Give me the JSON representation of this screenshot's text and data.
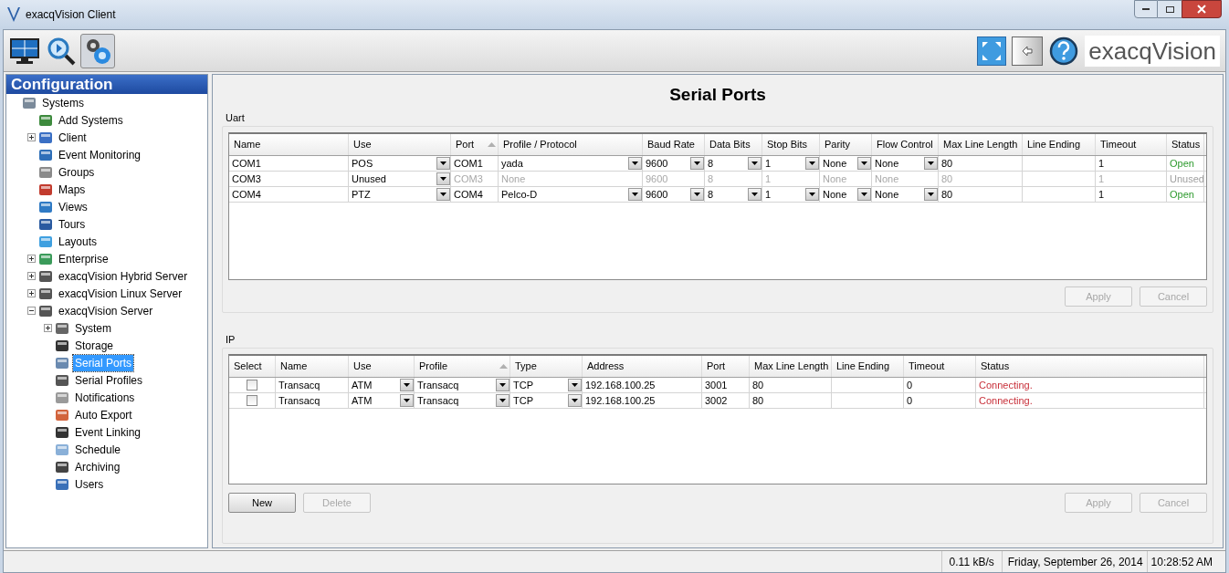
{
  "window": {
    "title": "exacqVision Client"
  },
  "toolbar": {
    "modes": [
      {
        "selected": false
      },
      {
        "selected": false
      },
      {
        "selected": true
      }
    ],
    "brand": "exacqVision"
  },
  "sidebar": {
    "title": "Configuration",
    "tree": [
      {
        "label": "Systems",
        "selected": false,
        "children": [
          {
            "label": "Add Systems",
            "selected": false
          },
          {
            "label": "Client",
            "selected": false,
            "expanded": false
          },
          {
            "label": "Event Monitoring",
            "selected": false
          },
          {
            "label": "Groups",
            "selected": false
          },
          {
            "label": "Maps",
            "selected": false
          },
          {
            "label": "Views",
            "selected": false
          },
          {
            "label": "Tours",
            "selected": false
          },
          {
            "label": "Layouts",
            "selected": false
          },
          {
            "label": "Enterprise",
            "selected": false,
            "expanded": false
          },
          {
            "label": "exacqVision Hybrid Server",
            "selected": false,
            "expanded": false
          },
          {
            "label": "exacqVision Linux Server",
            "selected": false,
            "expanded": false
          },
          {
            "label": "exacqVision Server",
            "selected": false,
            "expanded": true,
            "children": [
              {
                "label": "System",
                "selected": false,
                "expanded": false
              },
              {
                "label": "Storage",
                "selected": false
              },
              {
                "label": "Serial Ports",
                "selected": true
              },
              {
                "label": "Serial Profiles",
                "selected": false
              },
              {
                "label": "Notifications",
                "selected": false
              },
              {
                "label": "Auto Export",
                "selected": false
              },
              {
                "label": "Event Linking",
                "selected": false
              },
              {
                "label": "Schedule",
                "selected": false
              },
              {
                "label": "Archiving",
                "selected": false
              },
              {
                "label": "Users",
                "selected": false
              }
            ]
          }
        ]
      }
    ]
  },
  "page_title": "Serial Ports",
  "uart": {
    "label": "Uart",
    "columns": [
      {
        "label": "Name",
        "sorted": false
      },
      {
        "label": "Use",
        "sorted": false
      },
      {
        "label": "Port",
        "sorted": true
      },
      {
        "label": "Profile / Protocol",
        "sorted": false
      },
      {
        "label": "Baud Rate",
        "sorted": false
      },
      {
        "label": "Data Bits",
        "sorted": false
      },
      {
        "label": "Stop Bits",
        "sorted": false
      },
      {
        "label": "Parity",
        "sorted": false
      },
      {
        "label": "Flow Control",
        "sorted": false
      },
      {
        "label": "Max Line Length",
        "sorted": false
      },
      {
        "label": "Line Ending",
        "sorted": false
      },
      {
        "label": "Timeout",
        "sorted": false
      },
      {
        "label": "Status",
        "sorted": false
      }
    ],
    "rows": [
      {
        "disabled": false,
        "cells": [
          {
            "text": "COM1",
            "dropdown": false
          },
          {
            "text": "POS",
            "dropdown": true
          },
          {
            "text": "COM1",
            "dropdown": false
          },
          {
            "text": "yada",
            "dropdown": true
          },
          {
            "text": "9600",
            "dropdown": true
          },
          {
            "text": "8",
            "dropdown": true
          },
          {
            "text": "1",
            "dropdown": true
          },
          {
            "text": "None",
            "dropdown": true
          },
          {
            "text": "None",
            "dropdown": true
          },
          {
            "text": "80",
            "dropdown": false
          },
          {
            "text": ""
          },
          {
            "text": "1",
            "dropdown": false
          },
          {
            "text": "Open",
            "kind": "open"
          }
        ]
      },
      {
        "disabled": true,
        "cells": [
          {
            "text": "COM3",
            "dropdown": false
          },
          {
            "text": "Unused",
            "dropdown": true
          },
          {
            "text": "COM3",
            "dropdown": false
          },
          {
            "text": "None",
            "dropdown": false
          },
          {
            "text": "9600",
            "dropdown": false
          },
          {
            "text": "8",
            "dropdown": false
          },
          {
            "text": "1",
            "dropdown": false
          },
          {
            "text": "None",
            "dropdown": false
          },
          {
            "text": "None",
            "dropdown": false
          },
          {
            "text": "80",
            "dropdown": false
          },
          {
            "text": ""
          },
          {
            "text": "1",
            "dropdown": false
          },
          {
            "text": "Unused",
            "kind": "unused"
          }
        ]
      },
      {
        "disabled": false,
        "cells": [
          {
            "text": "COM4",
            "dropdown": false
          },
          {
            "text": "PTZ",
            "dropdown": true
          },
          {
            "text": "COM4",
            "dropdown": false
          },
          {
            "text": "Pelco-D",
            "dropdown": true
          },
          {
            "text": "9600",
            "dropdown": true
          },
          {
            "text": "8",
            "dropdown": true
          },
          {
            "text": "1",
            "dropdown": true
          },
          {
            "text": "None",
            "dropdown": true
          },
          {
            "text": "None",
            "dropdown": true
          },
          {
            "text": "80",
            "dropdown": false
          },
          {
            "text": ""
          },
          {
            "text": "1",
            "dropdown": false
          },
          {
            "text": "Open",
            "kind": "open"
          }
        ]
      }
    ],
    "buttons": [
      {
        "label": "Apply",
        "disabled": true
      },
      {
        "label": "Cancel",
        "disabled": true
      }
    ]
  },
  "ip": {
    "label": "IP",
    "columns": [
      {
        "label": "Select",
        "sorted": false
      },
      {
        "label": "Name",
        "sorted": false
      },
      {
        "label": "Use",
        "sorted": false
      },
      {
        "label": "Profile",
        "sorted": true
      },
      {
        "label": "Type",
        "sorted": false
      },
      {
        "label": "Address",
        "sorted": false
      },
      {
        "label": "Port",
        "sorted": false
      },
      {
        "label": "Max Line Length",
        "sorted": false
      },
      {
        "label": "Line Ending",
        "sorted": false
      },
      {
        "label": "Timeout",
        "sorted": false
      },
      {
        "label": "Status",
        "sorted": false
      }
    ],
    "rows": [
      {
        "checked": false,
        "name": "Transacq",
        "use": "ATM",
        "profile": "Transacq",
        "type": "TCP",
        "address": "192.168.100.25",
        "port": "3001",
        "max_line_length": "80",
        "timeout": "0",
        "status": "Connecting."
      },
      {
        "checked": false,
        "name": "Transacq",
        "use": "ATM",
        "profile": "Transacq",
        "type": "TCP",
        "address": "192.168.100.25",
        "port": "3002",
        "max_line_length": "80",
        "timeout": "0",
        "status": "Connecting."
      }
    ],
    "left_buttons": [
      {
        "label": "New",
        "disabled": false
      },
      {
        "label": "Delete",
        "disabled": true
      }
    ],
    "buttons": [
      {
        "label": "Apply",
        "disabled": true
      },
      {
        "label": "Cancel",
        "disabled": true
      }
    ]
  },
  "status_bar": {
    "rate": "0.11 kB/s",
    "date": "Friday, September 26, 2014",
    "time": "10:28:52 AM"
  }
}
